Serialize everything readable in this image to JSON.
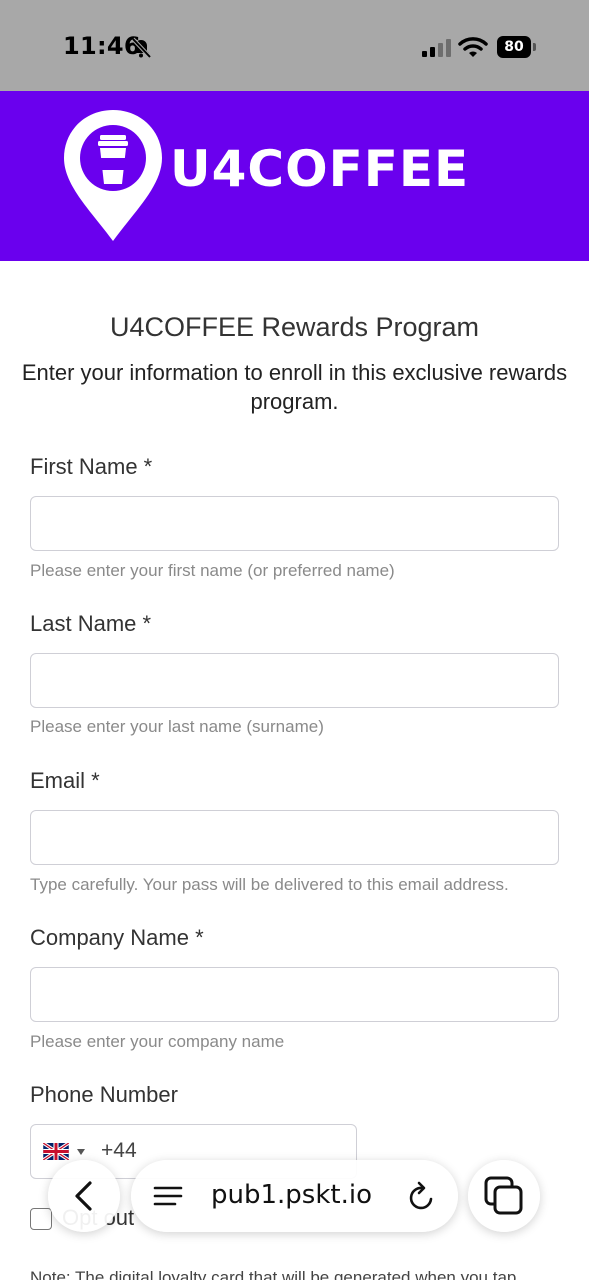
{
  "status_bar": {
    "time": "11:46",
    "battery": "80"
  },
  "brand": {
    "name": "U4COFFEE",
    "color": "#6a00ee"
  },
  "page": {
    "title": "U4COFFEE Rewards Program",
    "subtitle": "Enter your information to enroll in this exclusive rewards program."
  },
  "form": {
    "first_name": {
      "label": "First Name *",
      "value": "",
      "help": "Please enter your first name (or preferred name)"
    },
    "last_name": {
      "label": "Last Name *",
      "value": "",
      "help": "Please enter your last name (surname)"
    },
    "email": {
      "label": "Email *",
      "value": "",
      "help": "Type carefully. Your pass will be delivered to this email address."
    },
    "company": {
      "label": "Company Name *",
      "value": "",
      "help": "Please enter your company name"
    },
    "phone": {
      "label": "Phone Number",
      "dial_code": "+44",
      "country_flag": "uk-flag-icon"
    },
    "opt_out": {
      "label": "Opt out",
      "checked": false
    },
    "note": "Note: The digital loyalty card that will be generated when you tap"
  },
  "browser": {
    "url": "pub1.pskt.io",
    "icons": [
      "back-chevron-icon",
      "menu-icon",
      "reload-icon",
      "tabs-icon"
    ]
  }
}
